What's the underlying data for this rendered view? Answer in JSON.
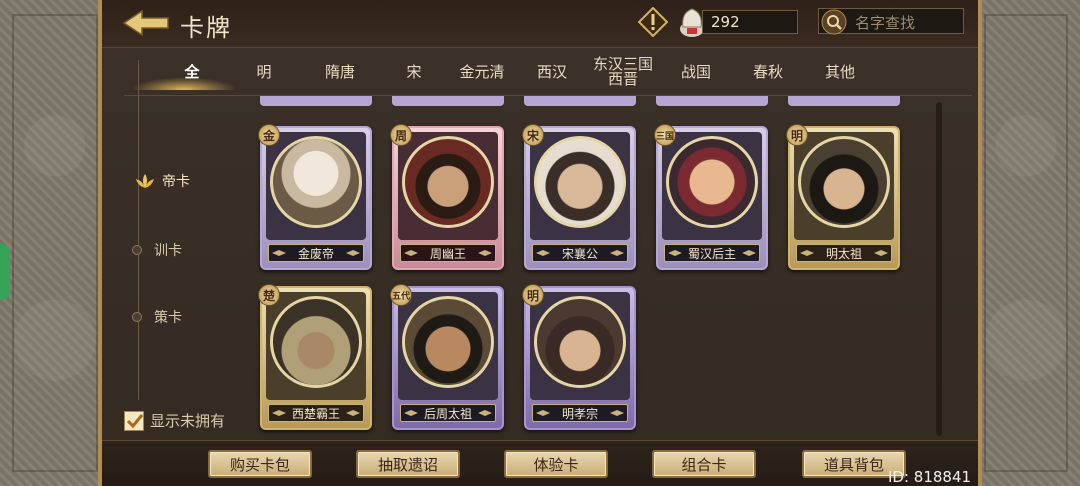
{
  "header": {
    "title": "卡牌",
    "currency_amount": "292",
    "search_placeholder": "名字查找"
  },
  "tabs": [
    {
      "label": "全",
      "active": true
    },
    {
      "label": "明"
    },
    {
      "label": "隋唐"
    },
    {
      "label": "宋"
    },
    {
      "label": "金元清"
    },
    {
      "label": "西汉"
    },
    {
      "label": "东汉三国西晋"
    },
    {
      "label": "战国"
    },
    {
      "label": "春秋"
    },
    {
      "label": "其他"
    }
  ],
  "categories": [
    {
      "label": "帝卡",
      "active": true
    },
    {
      "label": "训卡"
    },
    {
      "label": "策卡"
    }
  ],
  "show_unowned_label": "显示未拥有",
  "show_unowned_checked": true,
  "cards": [
    {
      "name": "金废帝",
      "badge": "金",
      "frame": "purple"
    },
    {
      "name": "周幽王",
      "badge": "周",
      "frame": "pink"
    },
    {
      "name": "宋襄公",
      "badge": "宋",
      "frame": "purple"
    },
    {
      "name": "蜀汉后主",
      "badge": "三国",
      "frame": "purple"
    },
    {
      "name": "明太祖",
      "badge": "明",
      "frame": "gold"
    },
    {
      "name": "西楚霸王",
      "badge": "楚",
      "frame": "gold"
    },
    {
      "name": "后周太祖",
      "badge": "五代",
      "frame": "purple"
    },
    {
      "name": "明孝宗",
      "badge": "明",
      "frame": "purple"
    }
  ],
  "bottom_buttons": [
    "购买卡包",
    "抽取遗诏",
    "体验卡",
    "组合卡",
    "道具背包"
  ],
  "id_label": "ID: 818841",
  "colors": {
    "accent_gold": "#d0b46c",
    "frame_purple": "#b6a6d3",
    "frame_pink": "#e1a8b4",
    "button_bg": "#e8d7b0"
  }
}
